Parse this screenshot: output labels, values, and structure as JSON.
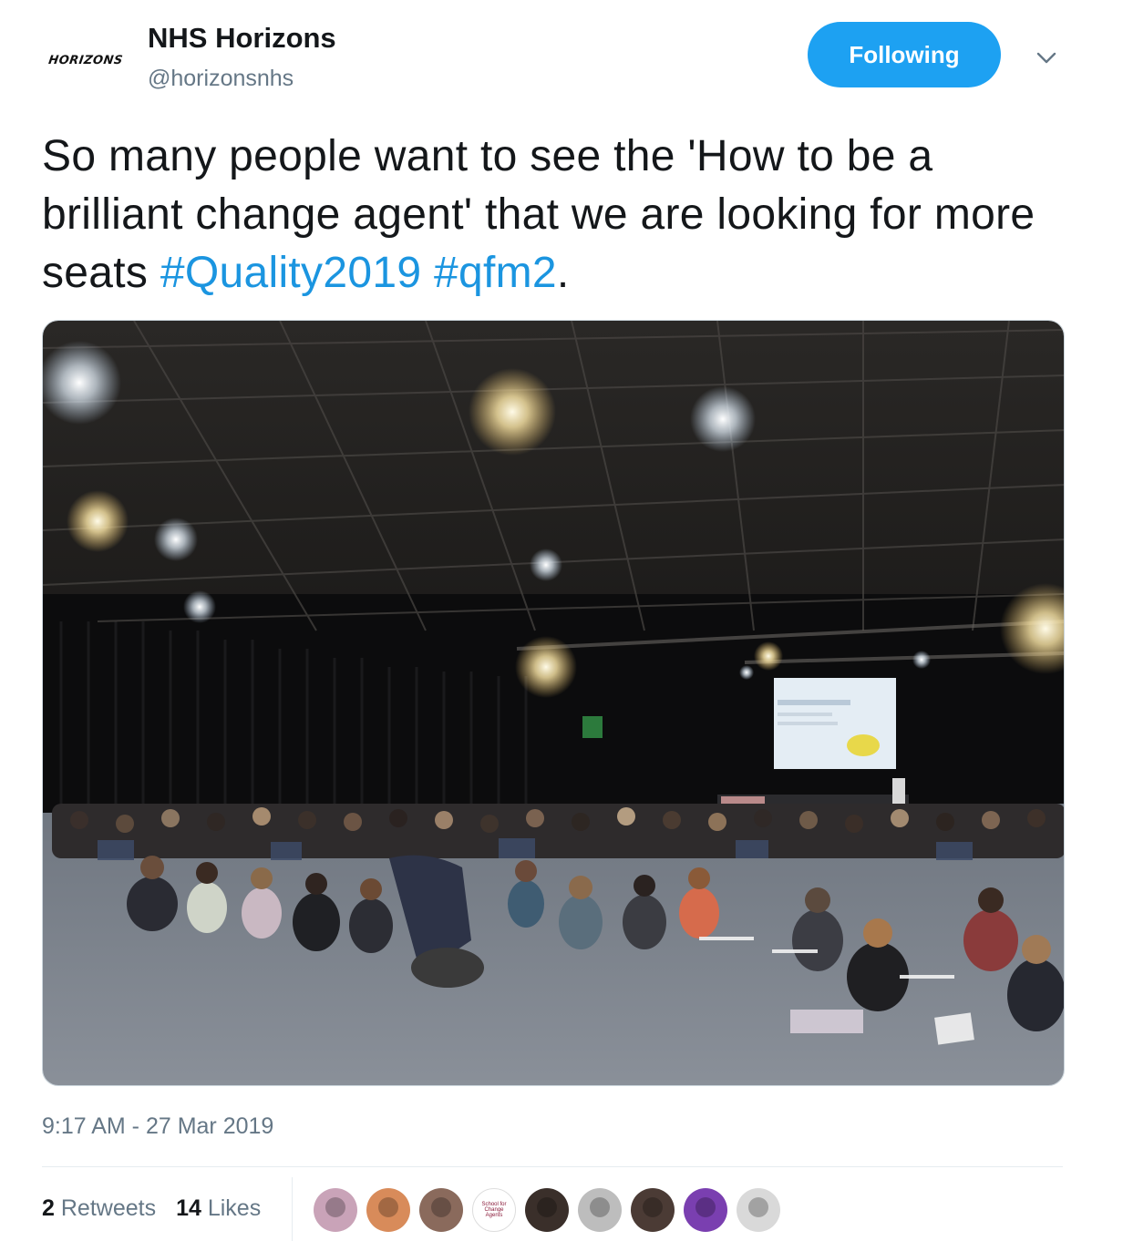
{
  "author": {
    "avatar_text": "HORIZONS",
    "display_name": "NHS Horizons",
    "handle": "@horizonsnhs"
  },
  "follow_button_label": "Following",
  "tweet": {
    "text_part1": "So many people want to see the 'How to be a brilliant change agent' that we are looking for more seats ",
    "hashtag1": "#Quality2019",
    "hashtag2": "#qfm2",
    "text_end": "."
  },
  "timestamp": "9:17 AM - 27 Mar 2019",
  "stats": {
    "retweets_count": "2",
    "retweets_label": "Retweets",
    "likes_count": "14",
    "likes_label": "Likes"
  },
  "likers": [
    {
      "color": "#c9a3b8"
    },
    {
      "color": "#d88b5a"
    },
    {
      "color": "#8a6a5c"
    },
    {
      "color": "#ffffff",
      "text": "School for Change Agents"
    },
    {
      "color": "#3a2f2a"
    },
    {
      "color": "#bdbdbd"
    },
    {
      "color": "#4b3b35"
    },
    {
      "color": "#7a3fb0"
    },
    {
      "color": "#d9d9d9"
    }
  ],
  "colors": {
    "accent": "#1da1f2",
    "hashtag": "#1b95e0",
    "muted": "#657786"
  }
}
